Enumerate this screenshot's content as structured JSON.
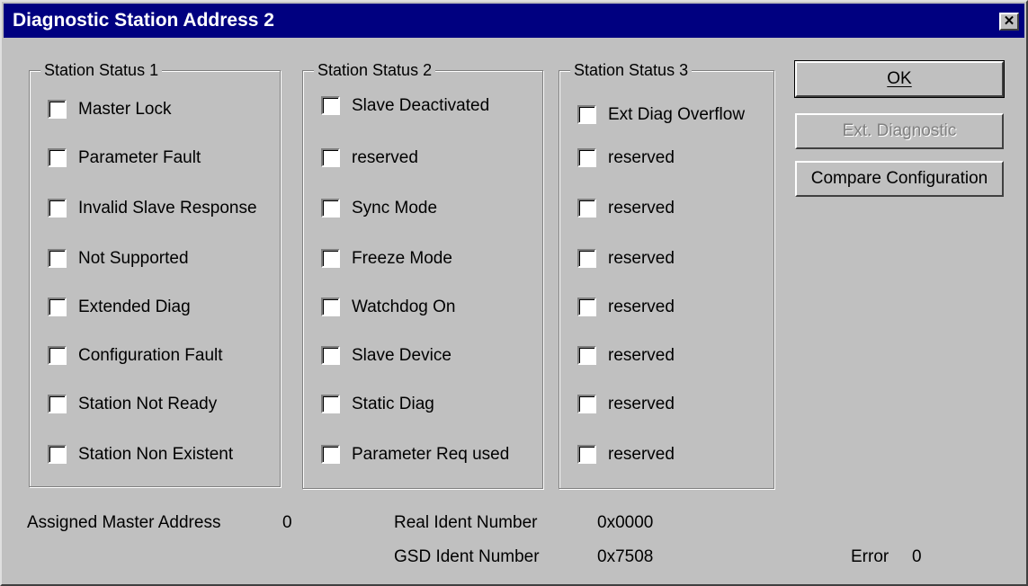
{
  "window": {
    "title": "Diagnostic Station Address 2",
    "close_glyph": "✕"
  },
  "groups": [
    {
      "label": "Station Status 1",
      "items": [
        "Master Lock",
        "Parameter Fault",
        "Invalid Slave Response",
        "Not Supported",
        "Extended Diag",
        "Configuration Fault",
        "Station Not Ready",
        "Station Non Existent"
      ],
      "checked": [
        false,
        false,
        false,
        false,
        false,
        false,
        false,
        false
      ]
    },
    {
      "label": "Station Status 2",
      "items": [
        "Slave Deactivated",
        "reserved",
        "Sync Mode",
        "Freeze Mode",
        "Watchdog On",
        "Slave Device",
        "Static Diag",
        "Parameter Req used"
      ],
      "checked": [
        false,
        false,
        false,
        false,
        false,
        false,
        false,
        false
      ]
    },
    {
      "label": "Station Status 3",
      "items": [
        "Ext Diag Overflow",
        "reserved",
        "reserved",
        "reserved",
        "reserved",
        "reserved",
        "reserved",
        "reserved"
      ],
      "checked": [
        false,
        false,
        false,
        false,
        false,
        false,
        false,
        false
      ]
    }
  ],
  "buttons": {
    "ok": "OK",
    "ext_diagnostic": "Ext. Diagnostic",
    "compare_configuration": "Compare Configuration"
  },
  "info": {
    "assigned_master_address_label": "Assigned Master Address",
    "assigned_master_address_value": "0",
    "real_ident_label": "Real Ident Number",
    "real_ident_value": "0x0000",
    "gsd_ident_label": "GSD Ident Number",
    "gsd_ident_value": "0x7508",
    "error_label": "Error",
    "error_value": "0"
  }
}
